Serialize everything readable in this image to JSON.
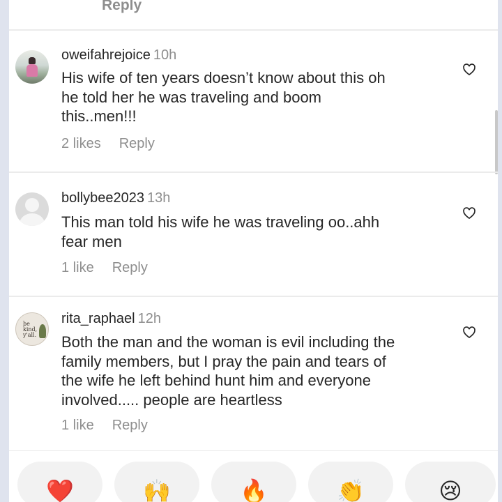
{
  "top_reply_label": "Reply",
  "comments": [
    {
      "username": "oweifahrejoice",
      "time": "10h",
      "lines": [
        "His wife of ten years doesn’t know about this oh",
        "he told her he was traveling and boom",
        "this..men!!!"
      ],
      "likes": "2 likes",
      "reply": "Reply"
    },
    {
      "username": "bollybee2023",
      "time": "13h",
      "lines": [
        "This man told his wife he was traveling oo..ahh",
        "fear men"
      ],
      "likes": "1 like",
      "reply": "Reply"
    },
    {
      "username": "rita_raphael",
      "time": "12h",
      "lines": [
        "Both the man and the woman is evil including the",
        "family members, but I pray  the pain and tears of",
        "the wife he left behind hunt him and everyone",
        "involved..... people are heartless"
      ],
      "likes": "1 like",
      "reply": "Reply"
    }
  ],
  "avatar_3_text": [
    "be",
    "kind,",
    "y'all."
  ],
  "reactions": [
    {
      "name": "red-heart",
      "glyph": "❤️"
    },
    {
      "name": "raising-hands",
      "glyph": "🙌"
    },
    {
      "name": "fire",
      "glyph": "🔥"
    },
    {
      "name": "clapping-hands",
      "glyph": "👏"
    },
    {
      "name": "crying-face",
      "glyph": "😢"
    }
  ],
  "colors": {
    "text": "#262626",
    "secondary": "#8e8e8e",
    "frame": "#dfe3ee",
    "pill": "#f2f2f2"
  }
}
